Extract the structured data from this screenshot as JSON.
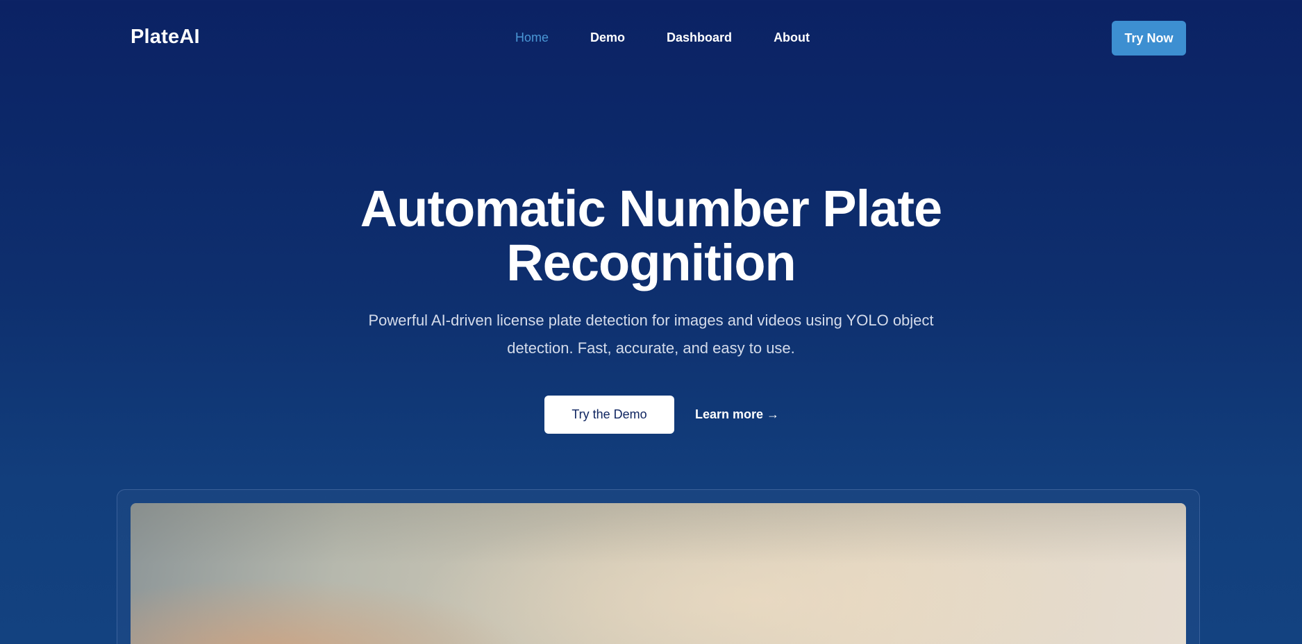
{
  "brand": {
    "name": "PlateAI"
  },
  "nav": {
    "items": [
      {
        "label": "Home",
        "active": true
      },
      {
        "label": "Demo",
        "active": false
      },
      {
        "label": "Dashboard",
        "active": false
      },
      {
        "label": "About",
        "active": false
      }
    ],
    "cta_label": "Try Now"
  },
  "hero": {
    "title_line1": "Automatic Number Plate",
    "title_line2": "Recognition",
    "subtitle_line1": "Powerful AI-driven license plate detection for images and videos using YOLO object",
    "subtitle_line2": "detection. Fast, accurate, and easy to use.",
    "primary_button": "Try the Demo",
    "secondary_link": "Learn more →"
  },
  "colors": {
    "background_top": "#0b2264",
    "background_bottom": "#134280",
    "accent": "#3d8fd1",
    "nav_active": "#4a97d6"
  }
}
